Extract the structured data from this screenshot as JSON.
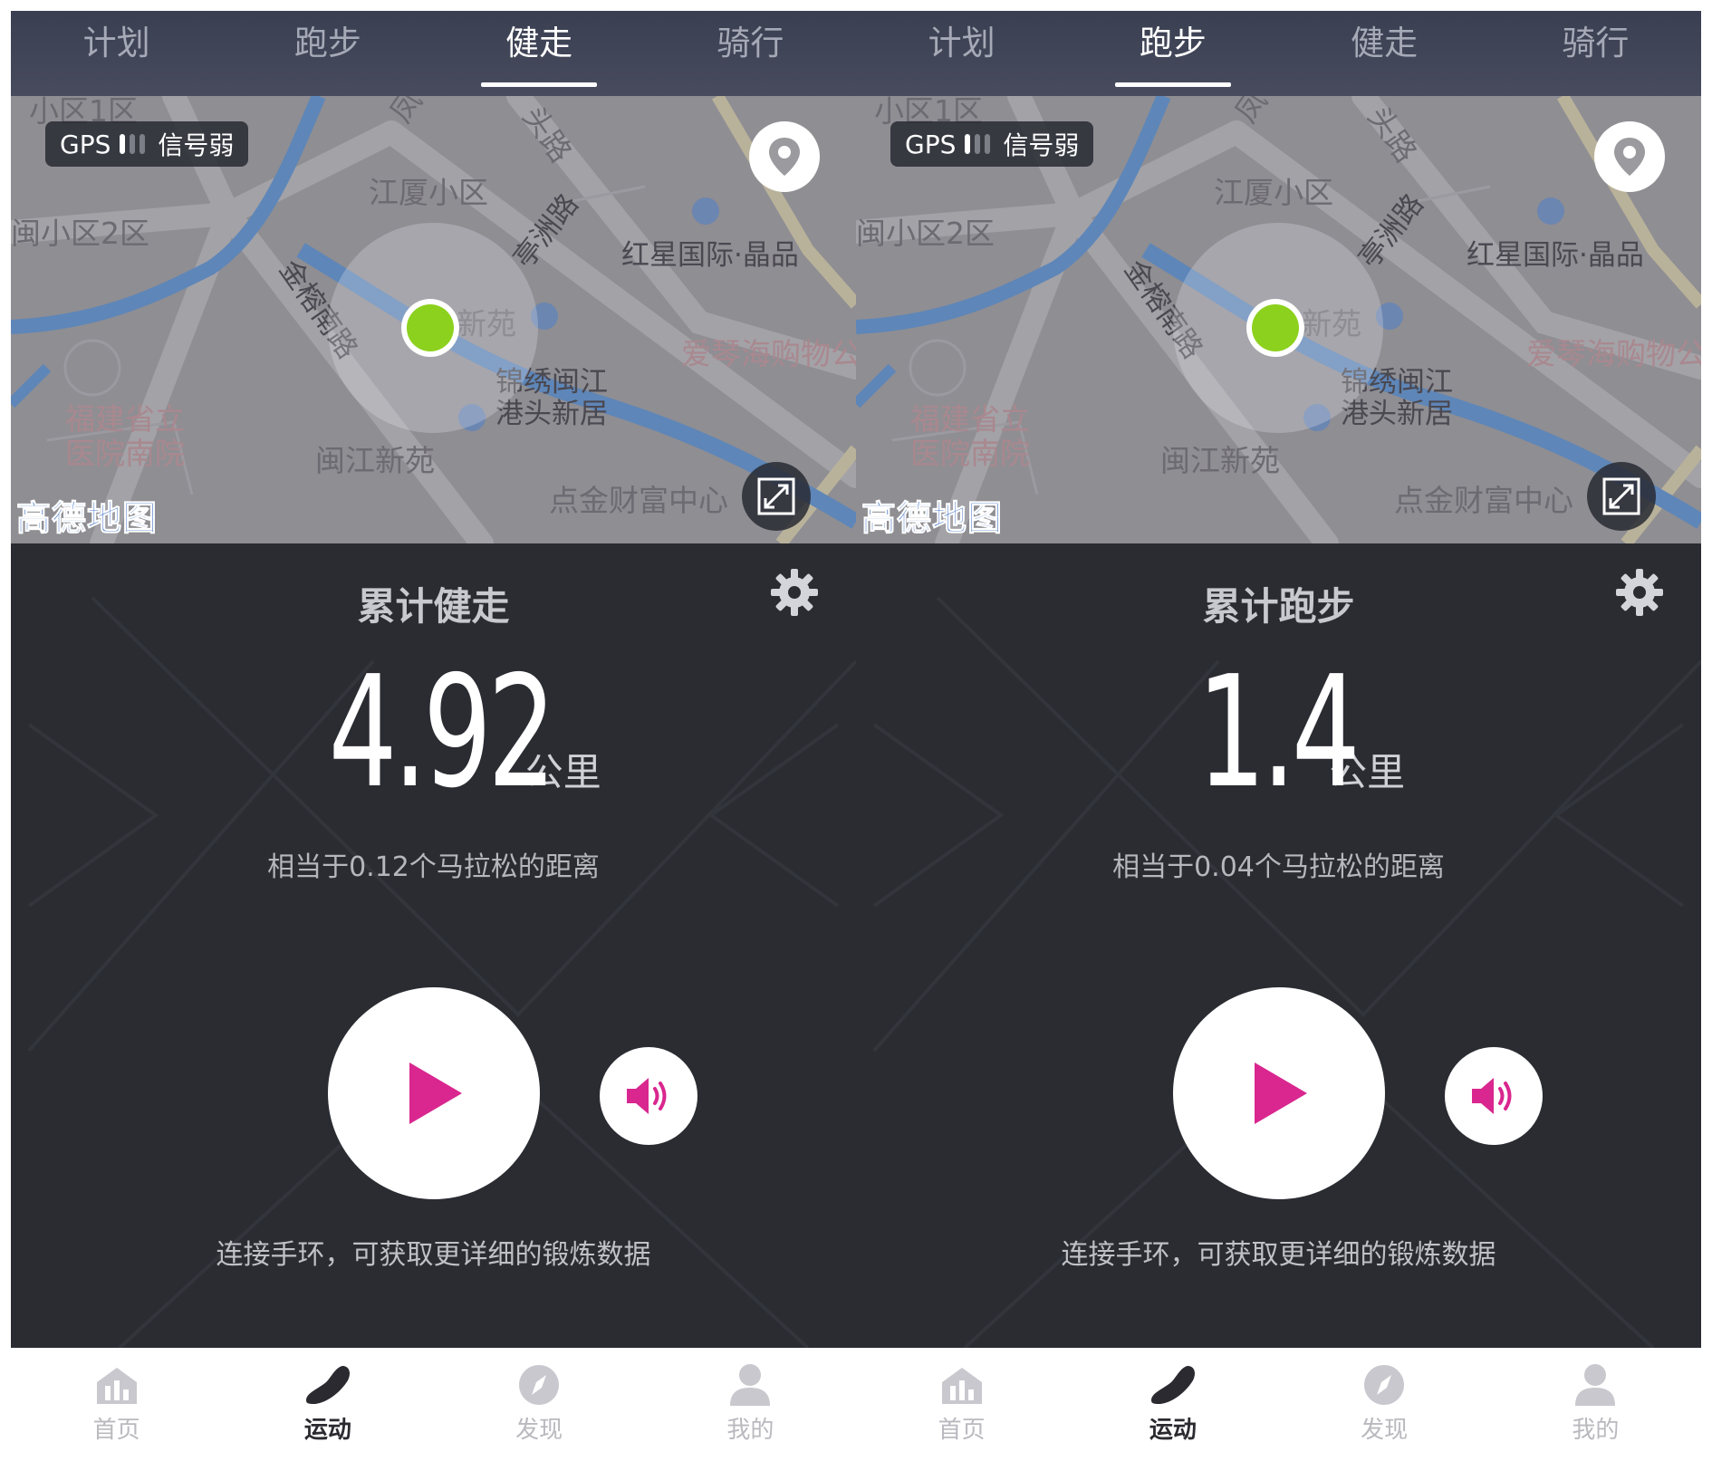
{
  "panels": [
    {
      "tabs": [
        "计划",
        "跑步",
        "健走",
        "骑行"
      ],
      "active_tab": 2,
      "map": {
        "gps_label": "GPS",
        "signal_text": "信号弱",
        "labels": [
          "小区1区",
          "凤",
          "头路",
          "江厦小区",
          "闽小区2区",
          "亭洲路",
          "红星国际·晶品",
          "金榕南路",
          "新苑",
          "锦绣闽江",
          "港头新居",
          "爱琴海购物公",
          "福建省立",
          "医院南院",
          "闽江新苑",
          "点金财富中心"
        ],
        "logo_text": "高德地图"
      },
      "stats": {
        "title": "累计健走",
        "distance_value": "4.92",
        "distance_unit": "公里",
        "marathon_text": "相当于0.12个马拉松的距离",
        "band_tip": "连接手环，可获取更详细的锻炼数据"
      }
    },
    {
      "tabs": [
        "计划",
        "跑步",
        "健走",
        "骑行"
      ],
      "active_tab": 1,
      "map": {
        "gps_label": "GPS",
        "signal_text": "信号弱",
        "labels": [
          "小区1区",
          "凤",
          "头路",
          "江厦小区",
          "闽小区2区",
          "亭洲路",
          "红星国际·晶品",
          "金榕南路",
          "新苑",
          "锦绣闽江",
          "港头新居",
          "爱琴海购物公",
          "福建省立",
          "医院南院",
          "闽江新苑",
          "点金财富中心"
        ],
        "logo_text": "高德地图"
      },
      "stats": {
        "title": "累计跑步",
        "distance_value": "1.4",
        "distance_unit": "公里",
        "marathon_text": "相当于0.04个马拉松的距离",
        "band_tip": "连接手环，可获取更详细的锻炼数据"
      }
    }
  ],
  "bottom_nav": {
    "items": [
      "首页",
      "运动",
      "发现",
      "我的"
    ],
    "active_index": 1
  },
  "colors": {
    "accent_magenta": "#d9278f",
    "gps_dot": "#8cd11e",
    "dark_bg": "#2a2c32",
    "map_bg": "#8e8d92",
    "river": "#5e86b8"
  }
}
